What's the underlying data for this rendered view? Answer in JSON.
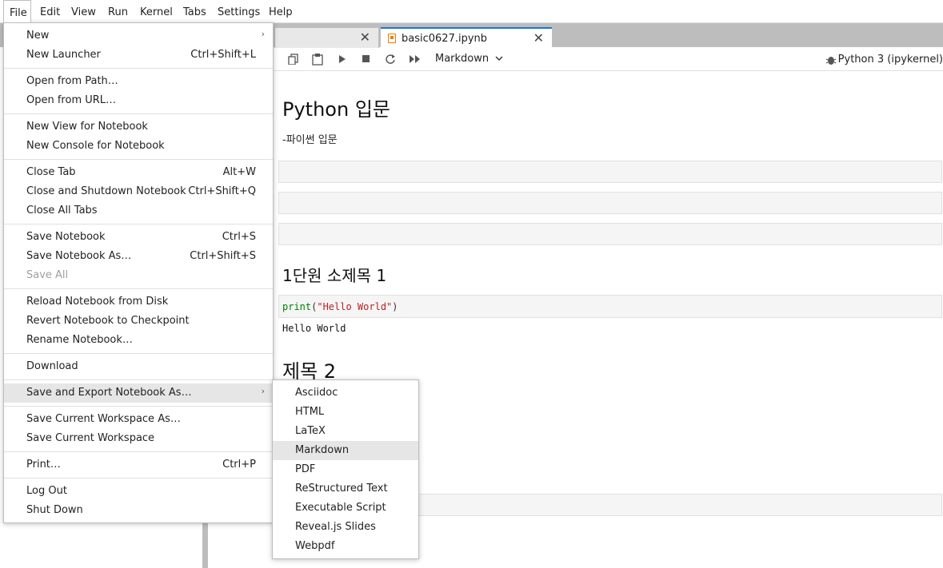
{
  "menubar": {
    "items": [
      "File",
      "Edit",
      "View",
      "Run",
      "Kernel",
      "Tabs",
      "Settings",
      "Help"
    ],
    "active": "File"
  },
  "tabs": {
    "inactive_close": "✕",
    "active_title": "basic0627.ipynb",
    "active_close": "✕",
    "active_icon": "notebook-icon"
  },
  "toolbar": {
    "cell_type": "Markdown",
    "kernel": "Python 3 (ipykernel)",
    "icons": [
      "copy-icon",
      "paste-icon",
      "run-icon",
      "stop-icon",
      "restart-icon",
      "fast-forward-icon",
      "bug-icon",
      "chevron-down-icon"
    ]
  },
  "notebook": {
    "heading1": "Python 입문",
    "paragraph": "-파이썬 입문",
    "heading3": "1단원 소제목 1",
    "code": {
      "fn": "print",
      "open": "(",
      "arg": "\"Hello World\"",
      "close": ")"
    },
    "output": "Hello World",
    "heading2": "제목 2"
  },
  "file_menu": {
    "items": [
      {
        "label": "New",
        "shortcut": "",
        "submenu": true
      },
      {
        "label": "New Launcher",
        "shortcut": "Ctrl+Shift+L"
      },
      {
        "label": "Open from Path…",
        "shortcut": ""
      },
      {
        "label": "Open from URL…",
        "shortcut": ""
      },
      {
        "label": "New View for Notebook",
        "shortcut": ""
      },
      {
        "label": "New Console for Notebook",
        "shortcut": ""
      },
      {
        "label": "Close Tab",
        "shortcut": "Alt+W"
      },
      {
        "label": "Close and Shutdown Notebook",
        "shortcut": "Ctrl+Shift+Q"
      },
      {
        "label": "Close All Tabs",
        "shortcut": ""
      },
      {
        "label": "Save Notebook",
        "shortcut": "Ctrl+S"
      },
      {
        "label": "Save Notebook As…",
        "shortcut": "Ctrl+Shift+S"
      },
      {
        "label": "Save All",
        "shortcut": "",
        "disabled": true
      },
      {
        "label": "Reload Notebook from Disk",
        "shortcut": ""
      },
      {
        "label": "Revert Notebook to Checkpoint",
        "shortcut": ""
      },
      {
        "label": "Rename Notebook…",
        "shortcut": ""
      },
      {
        "label": "Download",
        "shortcut": ""
      },
      {
        "label": "Save and Export Notebook As…",
        "shortcut": "",
        "submenu": true,
        "highlighted": true
      },
      {
        "label": "Save Current Workspace As…",
        "shortcut": ""
      },
      {
        "label": "Save Current Workspace",
        "shortcut": ""
      },
      {
        "label": "Print…",
        "shortcut": "Ctrl+P"
      },
      {
        "label": "Log Out",
        "shortcut": ""
      },
      {
        "label": "Shut Down",
        "shortcut": ""
      }
    ]
  },
  "export_submenu": {
    "items": [
      "Asciidoc",
      "HTML",
      "LaTeX",
      "Markdown",
      "PDF",
      "ReStructured Text",
      "Executable Script",
      "Reveal.js Slides",
      "Webpdf"
    ],
    "highlighted": "Markdown"
  },
  "colors": {
    "accent": "#1976d2",
    "tab_strip": "#bdbdbd",
    "highlight": "#e6e6e6",
    "code_keyword": "#008000",
    "code_string": "#ba2121"
  }
}
